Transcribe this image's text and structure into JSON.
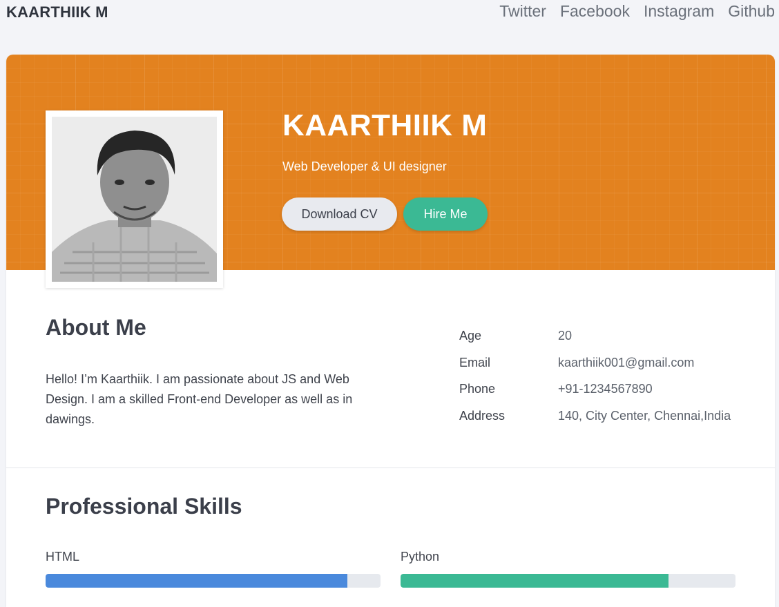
{
  "nav": {
    "brand": "KAARTHIIK M",
    "links": [
      "Twitter",
      "Facebook",
      "Instagram",
      "Github"
    ]
  },
  "hero": {
    "name": "KAARTHIIK M",
    "role": "Web Developer & UI designer",
    "download_label": "Download CV",
    "hire_label": "Hire Me"
  },
  "about": {
    "title": "About Me",
    "text": "Hello! I’m Kaarthiik. I am passionate about JS and Web Design. I am a skilled Front-end Developer as well as in dawings.",
    "info": [
      {
        "key": "Age",
        "value": "20"
      },
      {
        "key": "Email",
        "value": "kaarthiik001@gmail.com"
      },
      {
        "key": "Phone",
        "value": "+91-1234567890"
      },
      {
        "key": "Address",
        "value": "140, City Center, Chennai,India"
      }
    ]
  },
  "skills": {
    "title": "Professional Skills",
    "items": [
      {
        "label": "HTML",
        "level": 0.9
      },
      {
        "label": "Python",
        "level": 0.8
      }
    ]
  },
  "colors": {
    "hero_orange": "#e3821f",
    "hire_green": "#3bb994",
    "html_bar": "#4a89dc",
    "python_bar": "#3bb994"
  }
}
